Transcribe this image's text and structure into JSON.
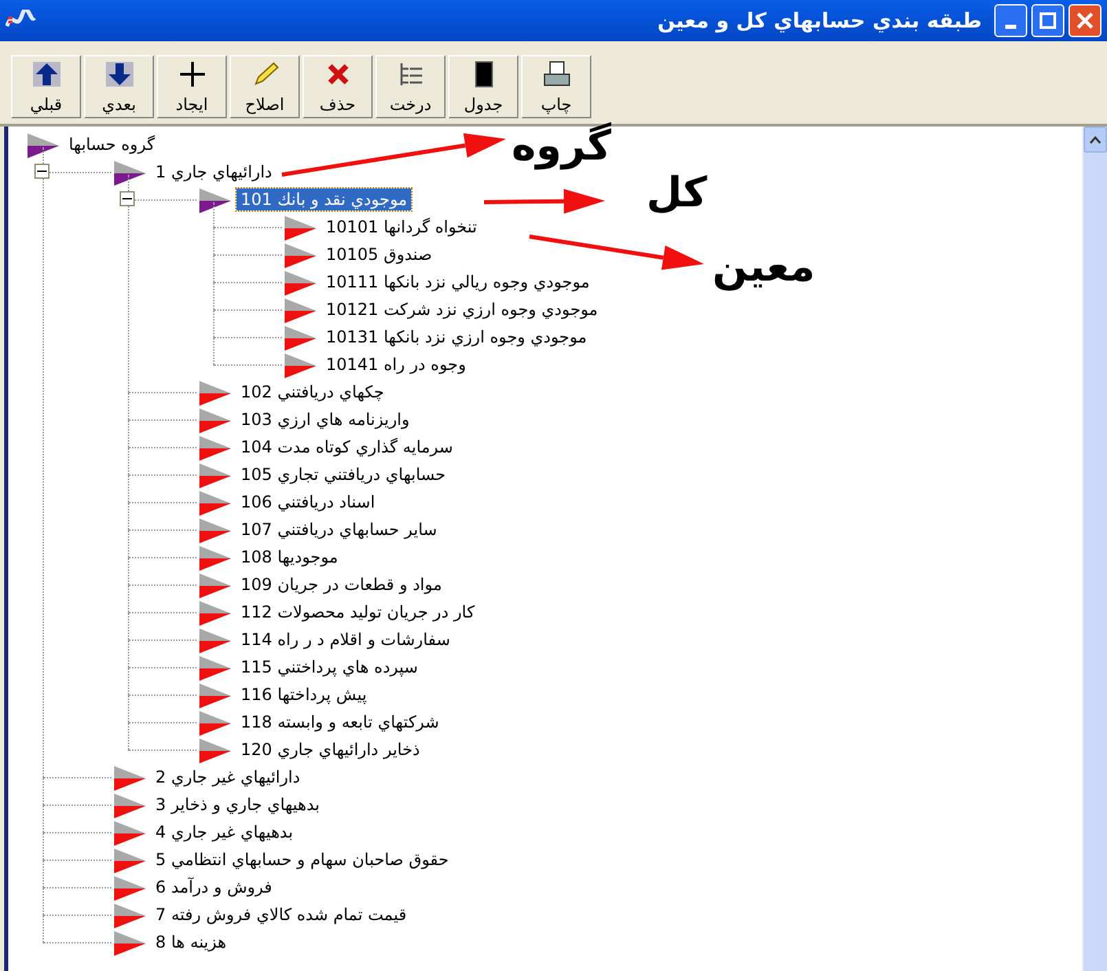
{
  "window": {
    "title": "طبقه بندي حسابهاي كل و معين"
  },
  "toolbar": [
    {
      "label": "چاپ",
      "kind": "print"
    },
    {
      "label": "جدول",
      "kind": "table"
    },
    {
      "label": "درخت",
      "kind": "tree"
    },
    {
      "label": "حذف",
      "kind": "delete"
    },
    {
      "label": "اصلاح",
      "kind": "edit"
    },
    {
      "label": "ايجاد",
      "kind": "add"
    },
    {
      "label": "بعدي",
      "kind": "down"
    },
    {
      "label": "قبلي",
      "kind": "up"
    }
  ],
  "tree": [
    {
      "label": "گروه حسابها",
      "selected": false,
      "expanded": true,
      "children": [
        {
          "label": "دارائيهاي جاري 1",
          "selected": false,
          "expanded": true,
          "children": [
            {
              "label": "موجودي نقد و بانك 101",
              "selected": true,
              "expanded": true,
              "children": [
                {
                  "label": "تنخواه گردانها 10101",
                  "selected": false
                },
                {
                  "label": "صندوق 10105",
                  "selected": false
                },
                {
                  "label": "موجودي وجوه ريالي نزد بانكها 10111",
                  "selected": false
                },
                {
                  "label": "موجودي وجوه ارزي نزد شركت 10121",
                  "selected": false
                },
                {
                  "label": "موجودي وجوه ارزي نزد بانكها 10131",
                  "selected": false
                },
                {
                  "label": "وجوه در راه 10141",
                  "selected": false
                }
              ]
            },
            {
              "label": "چكهاي دريافتني 102",
              "selected": false
            },
            {
              "label": "واريزنامه هاي ارزي 103",
              "selected": false
            },
            {
              "label": "سرمايه گذاري كوتاه مدت 104",
              "selected": false
            },
            {
              "label": "حسابهاي دريافتني تجاري 105",
              "selected": false
            },
            {
              "label": "اسناد دريافتني 106",
              "selected": false
            },
            {
              "label": "ساير حسابهاي دريافتني 107",
              "selected": false
            },
            {
              "label": "موجوديها 108",
              "selected": false
            },
            {
              "label": "مواد و قطعات در جريان 109",
              "selected": false
            },
            {
              "label": "كار در جريان توليد محصولات 112",
              "selected": false
            },
            {
              "label": "سفارشات و اقلام د ر راه 114",
              "selected": false
            },
            {
              "label": "سپرده هاي پرداختني 115",
              "selected": false
            },
            {
              "label": "پيش پرداختها 116",
              "selected": false
            },
            {
              "label": "شركتهاي تابعه و وابسته 118",
              "selected": false
            },
            {
              "label": "ذخاير دارائيهاي جاري 120",
              "selected": false
            }
          ]
        },
        {
          "label": "دارائيهاي غير جاري 2",
          "selected": false
        },
        {
          "label": "بدهيهاي جاري و ذخاير 3",
          "selected": false
        },
        {
          "label": "بدهيهاي غير جاري 4",
          "selected": false
        },
        {
          "label": "حقوق صاحبان سهام و حسابهاي انتظامي 5",
          "selected": false
        },
        {
          "label": "فروش و درآمد 6",
          "selected": false
        },
        {
          "label": "قيمت تمام شده كالاي فروش رفته 7",
          "selected": false
        },
        {
          "label": "هزينه ها 8",
          "selected": false
        }
      ]
    }
  ],
  "annotations": [
    {
      "label": "گروه"
    },
    {
      "label": "کل"
    },
    {
      "label": "معين"
    }
  ]
}
